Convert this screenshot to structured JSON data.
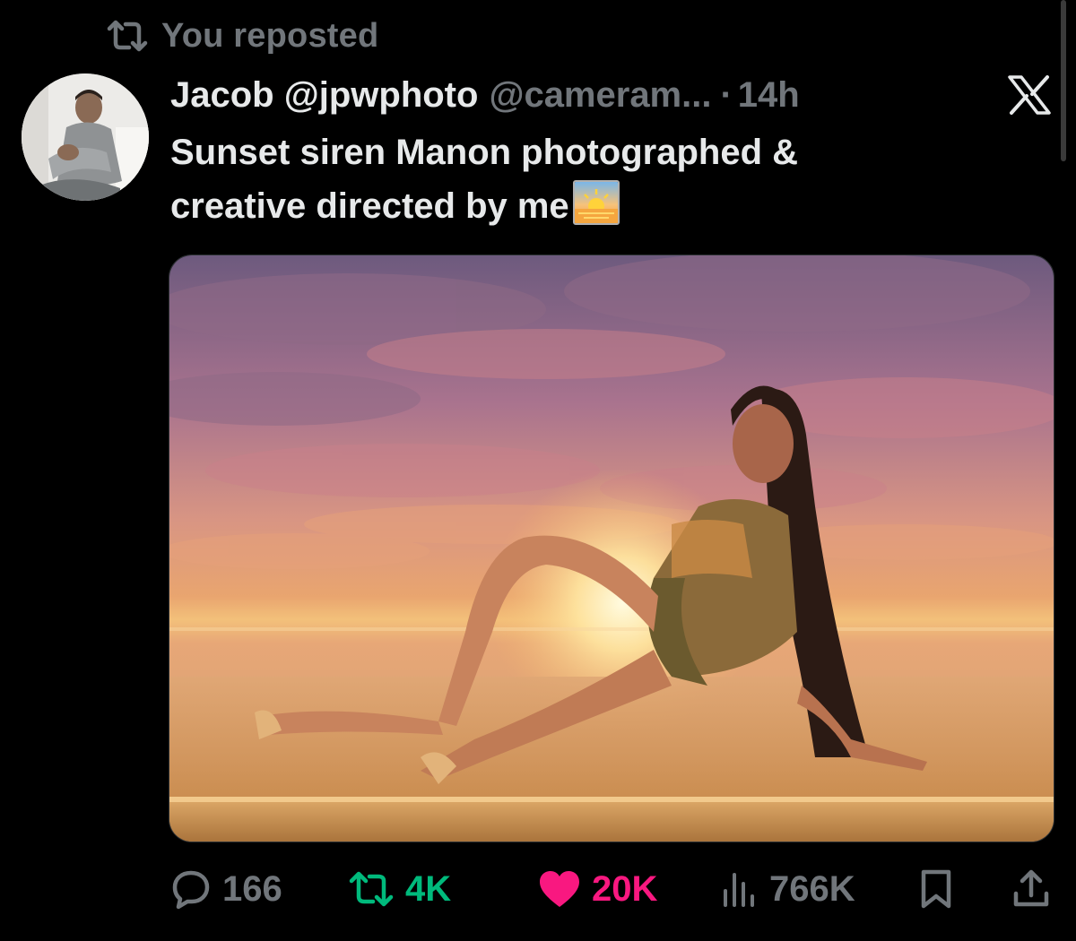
{
  "repost_banner": {
    "text": "You reposted",
    "icon": "repost-icon"
  },
  "tweet": {
    "display_name": "Jacob @jpwphoto",
    "handle": "@cameram...",
    "separator": "·",
    "time": "14h",
    "text_line1": "Sunset siren Manon photographed &",
    "text_line2": "creative directed by me",
    "emoji": "sunrise-emoji",
    "avatar": "avatar-photo",
    "media": "sunset-photo"
  },
  "actions": {
    "replies": "166",
    "reposts": "4K",
    "likes": "20K",
    "views": "766K"
  },
  "colors": {
    "background": "#000000",
    "text": "#e7e9ea",
    "muted": "#71767b",
    "repost_active": "#00ba7c",
    "like_active": "#f91880"
  }
}
